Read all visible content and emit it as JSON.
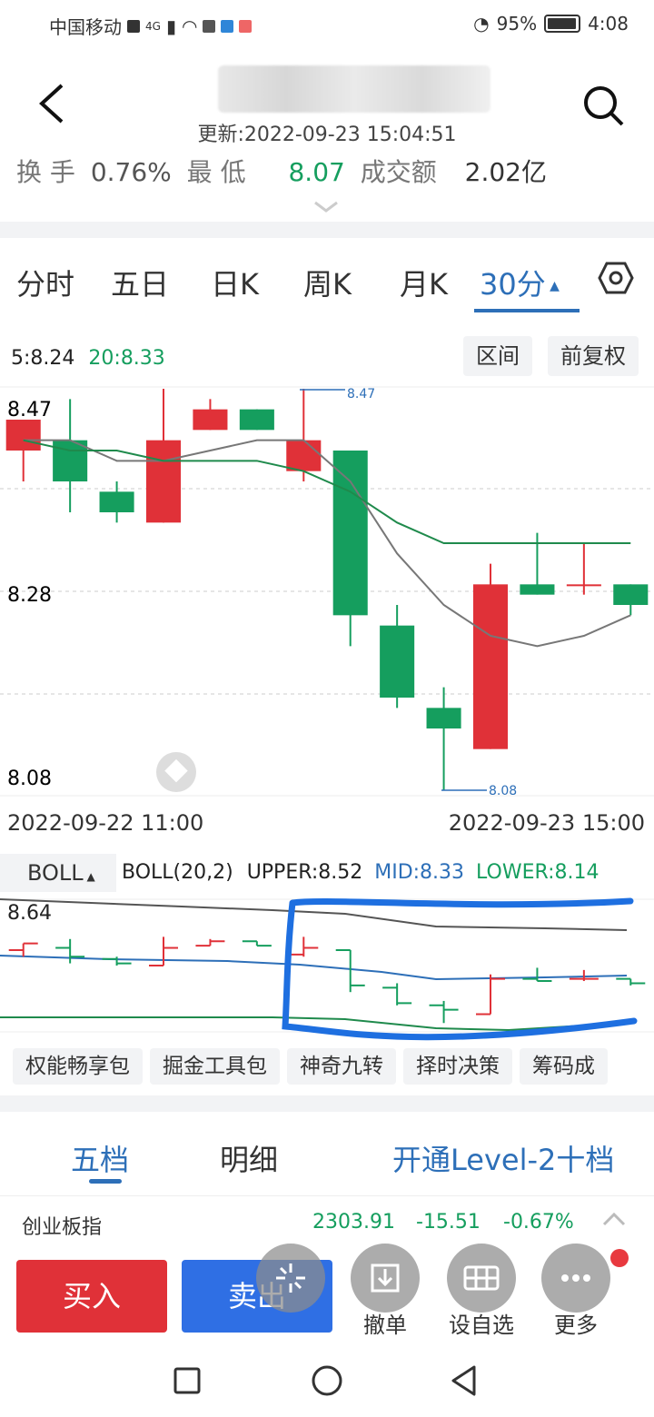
{
  "status_bar": {
    "carrier": "中国移动",
    "network": "4G",
    "battery": "95%",
    "time": "4:08"
  },
  "header": {
    "update_time": "更新:2022-09-23 15:04:51",
    "info": {
      "turnover_label": "换 手",
      "turnover_value": "0.76%",
      "low_label": "最 低",
      "low_value": "8.07",
      "amount_label": "成交额",
      "amount_value": "2.02亿"
    }
  },
  "period_tabs": [
    "分时",
    "五日",
    "日K",
    "周K",
    "月K",
    "30分"
  ],
  "active_period": "30分",
  "ma": {
    "ma5": "5:8.24",
    "ma20": "20:8.33"
  },
  "chart_buttons": {
    "range": "区间",
    "adjust": "前复权"
  },
  "chart_data": {
    "type": "candlestick",
    "y_ticks": [
      "8.47",
      "8.28",
      "8.08"
    ],
    "ylim": [
      8.08,
      8.47
    ],
    "x_start_label": "2022-09-22 11:00",
    "x_end_label": "2022-09-23 15:00",
    "high_marker": "8.47",
    "low_marker": "8.08",
    "candles": [
      {
        "open": 8.41,
        "close": 8.44,
        "high": 8.44,
        "low": 8.38
      },
      {
        "open": 8.42,
        "close": 8.38,
        "high": 8.46,
        "low": 8.35
      },
      {
        "open": 8.37,
        "close": 8.35,
        "high": 8.38,
        "low": 8.34
      },
      {
        "open": 8.34,
        "close": 8.42,
        "high": 8.47,
        "low": 8.34
      },
      {
        "open": 8.43,
        "close": 8.45,
        "high": 8.46,
        "low": 8.43
      },
      {
        "open": 8.45,
        "close": 8.43,
        "high": 8.45,
        "low": 8.43
      },
      {
        "open": 8.39,
        "close": 8.42,
        "high": 8.47,
        "low": 8.38
      },
      {
        "open": 8.41,
        "close": 8.25,
        "high": 8.41,
        "low": 8.22
      },
      {
        "open": 8.24,
        "close": 8.17,
        "high": 8.26,
        "low": 8.16
      },
      {
        "open": 8.16,
        "close": 8.14,
        "high": 8.18,
        "low": 8.08
      },
      {
        "open": 8.12,
        "close": 8.28,
        "high": 8.3,
        "low": 8.12
      },
      {
        "open": 8.28,
        "close": 8.27,
        "high": 8.33,
        "low": 8.27
      },
      {
        "open": 8.28,
        "close": 8.28,
        "high": 8.32,
        "low": 8.27
      },
      {
        "open": 8.28,
        "close": 8.26,
        "high": 8.28,
        "low": 8.25
      }
    ],
    "ma5": [
      8.42,
      8.42,
      8.4,
      8.4,
      8.41,
      8.42,
      8.42,
      8.38,
      8.31,
      8.26,
      8.23,
      8.22,
      8.23,
      8.25
    ],
    "ma20": [
      8.42,
      8.41,
      8.41,
      8.4,
      8.4,
      8.4,
      8.39,
      8.37,
      8.34,
      8.32,
      8.32,
      8.32,
      8.32,
      8.32
    ]
  },
  "boll": {
    "selector": "BOLL",
    "params": "BOLL(20,2)",
    "upper": "UPPER:8.52",
    "mid": "MID:8.33",
    "lower": "LOWER:8.14",
    "y_top_label": "8.64"
  },
  "tools": [
    "权能畅享包",
    "掘金工具包",
    "神奇九转",
    "择时决策",
    "筹码成"
  ],
  "depth_tabs": {
    "five": "五档",
    "detail": "明细",
    "level2": "开通Level-2十档"
  },
  "index_row": {
    "name": "创业板指",
    "value": "2303.91",
    "change": "-15.51",
    "pct": "-0.67%"
  },
  "actions": {
    "buy": "买入",
    "sell": "卖出",
    "cancel": "撤单",
    "watchlist": "设自选",
    "more": "更多"
  },
  "colors": {
    "up": "#e03138",
    "down": "#159e5e",
    "accent": "#2d6fb8"
  }
}
